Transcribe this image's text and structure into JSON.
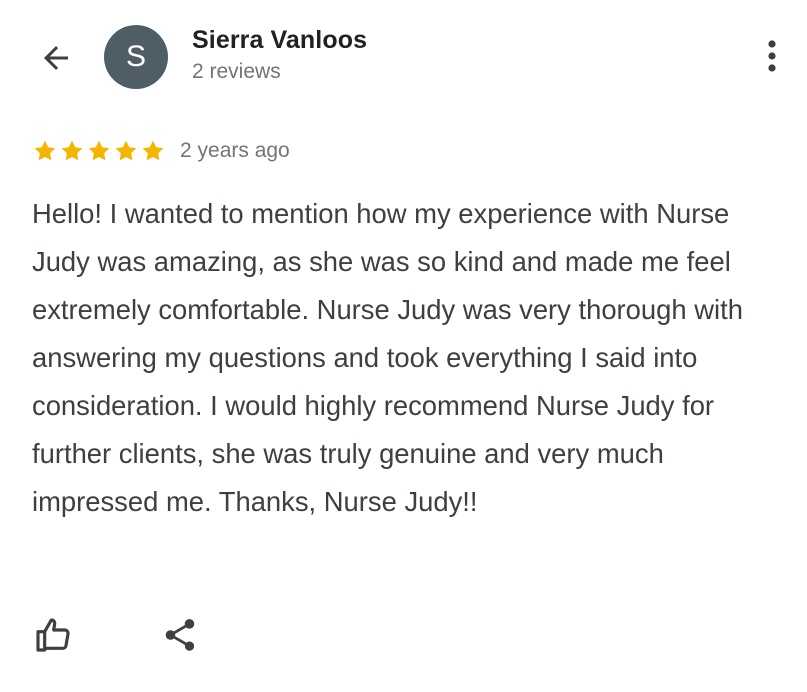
{
  "header": {
    "back_icon": "arrow-left-icon",
    "avatar_initial": "S",
    "avatar_color": "#4e5d66",
    "reviewer_name": "Sierra Vanloos",
    "review_count": "2 reviews",
    "more_icon": "more-vertical-icon"
  },
  "review": {
    "rating": 5,
    "rating_max": 5,
    "star_color": "#f4b400",
    "time_ago": "2 years ago",
    "text": "Hello! I wanted to mention how my experience with Nurse Judy was amazing, as she was so kind and made me feel extremely comfortable. Nurse Judy was very thorough with answering my questions and took everything I said into consideration. I would highly recommend Nurse Judy for further clients, she was truly genuine and very much impressed me. Thanks, Nurse Judy!!"
  },
  "actions": {
    "like_icon": "thumbs-up-icon",
    "share_icon": "share-icon"
  }
}
